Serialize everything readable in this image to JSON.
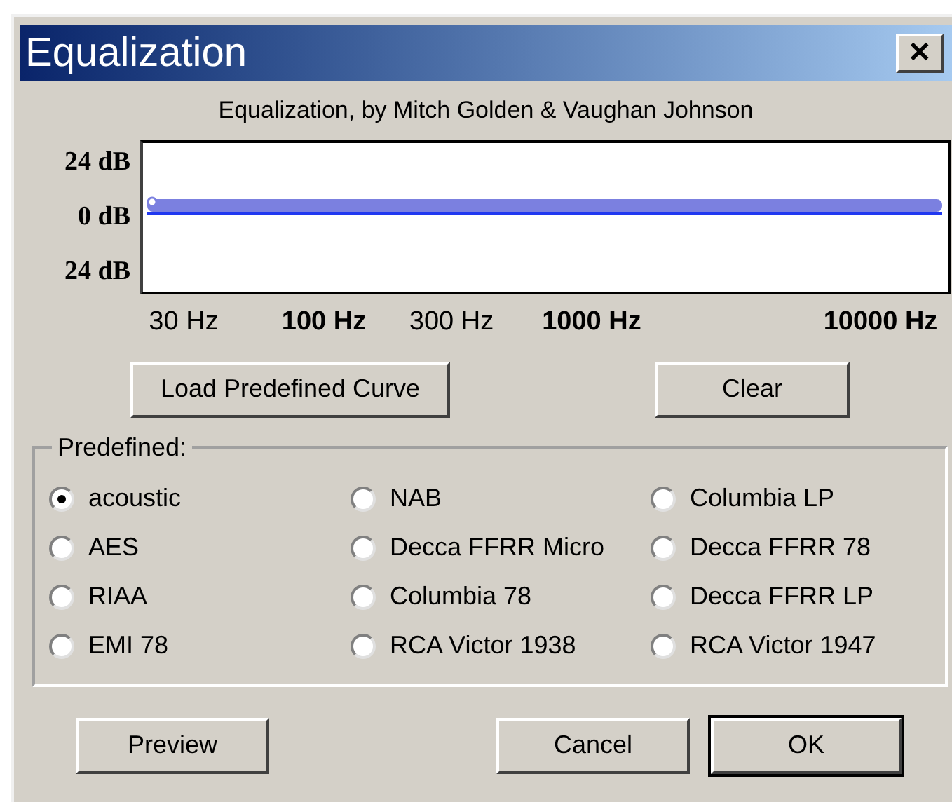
{
  "window": {
    "title": "Equalization",
    "close": "✕"
  },
  "subtitle": "Equalization, by Mitch Golden & Vaughan Johnson",
  "graph": {
    "y_labels": [
      "24 dB",
      "0 dB",
      "24 dB"
    ],
    "x_labels": [
      {
        "text": "30 Hz",
        "bold": false
      },
      {
        "text": "100 Hz",
        "bold": true
      },
      {
        "text": "300 Hz",
        "bold": false
      },
      {
        "text": "1000 Hz",
        "bold": true
      },
      {
        "text": "10000 Hz",
        "bold": true
      }
    ]
  },
  "curve_buttons": [
    "Load Predefined Curve",
    "Clear"
  ],
  "predefined": {
    "label": "Predefined:",
    "options": [
      {
        "label": "acoustic",
        "selected": true
      },
      {
        "label": "AES",
        "selected": false
      },
      {
        "label": "RIAA",
        "selected": false
      },
      {
        "label": "EMI 78",
        "selected": false
      },
      {
        "label": "NAB",
        "selected": false
      },
      {
        "label": "Decca FFRR Micro",
        "selected": false
      },
      {
        "label": "Columbia 78",
        "selected": false
      },
      {
        "label": "RCA Victor 1938",
        "selected": false
      },
      {
        "label": "Columbia LP",
        "selected": false
      },
      {
        "label": "Decca FFRR 78",
        "selected": false
      },
      {
        "label": "Decca FFRR LP",
        "selected": false
      },
      {
        "label": "RCA Victor 1947",
        "selected": false
      }
    ]
  },
  "buttons": [
    {
      "label": "Preview",
      "default": false
    },
    {
      "label": "Cancel",
      "default": false
    },
    {
      "label": "OK",
      "default": true
    }
  ]
}
